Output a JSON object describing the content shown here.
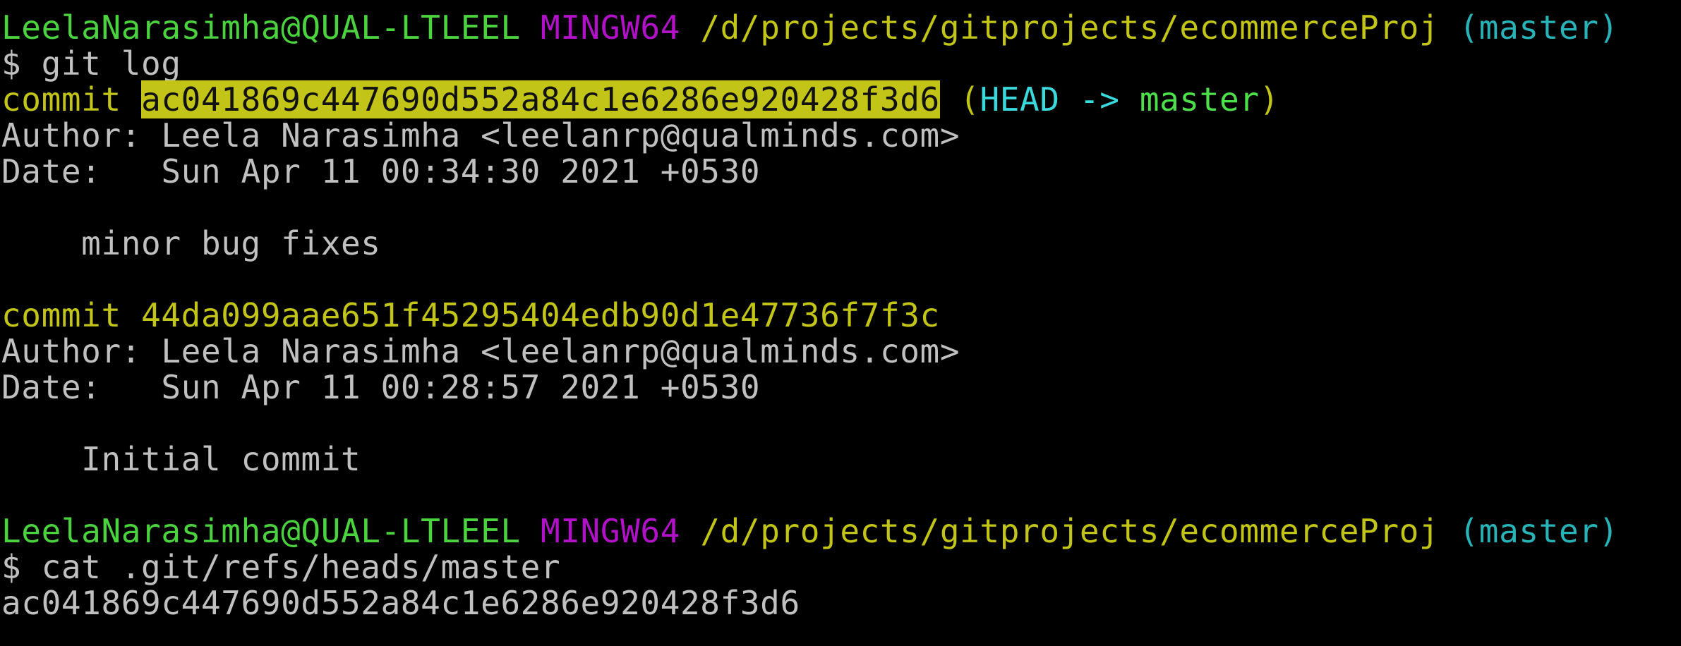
{
  "colors": {
    "background": "#000000",
    "prompt_user": "#4ad33e",
    "prompt_env": "#b112c7",
    "prompt_path": "#c2c417",
    "prompt_branch": "#28b3b8",
    "commit_line": "#c2c417",
    "text": "#c0c0c0",
    "highlight": "#c2c417"
  },
  "prompt1": {
    "user": "LeelaNarasimha@QUAL-LTLEEL",
    "env": "MINGW64",
    "path": "/d/projects/gitprojects/ecommerceProj",
    "branch": "(master)"
  },
  "cmd1": "$ git log",
  "log": [
    {
      "commit_word": "commit",
      "hash": "ac041869c447690d552a84c1e6286e920428f3d6",
      "ref_open": "(",
      "ref_head": "HEAD ->",
      "ref_branch": "master",
      "ref_close": ")",
      "author": "Author: Leela Narasimha <leelanrp@qualminds.com>",
      "date": "Date:   Sun Apr 11 00:34:30 2021 +0530",
      "message": "    minor bug fixes"
    },
    {
      "commit_word": "commit",
      "hash": "44da099aae651f45295404edb90d1e47736f7f3c",
      "author": "Author: Leela Narasimha <leelanrp@qualminds.com>",
      "date": "Date:   Sun Apr 11 00:28:57 2021 +0530",
      "message": "    Initial commit"
    }
  ],
  "prompt2": {
    "user": "LeelaNarasimha@QUAL-LTLEEL",
    "env": "MINGW64",
    "path": "/d/projects/gitprojects/ecommerceProj",
    "branch": "(master)"
  },
  "cmd2": "$ cat .git/refs/heads/master",
  "output2": "ac041869c447690d552a84c1e6286e920428f3d6"
}
